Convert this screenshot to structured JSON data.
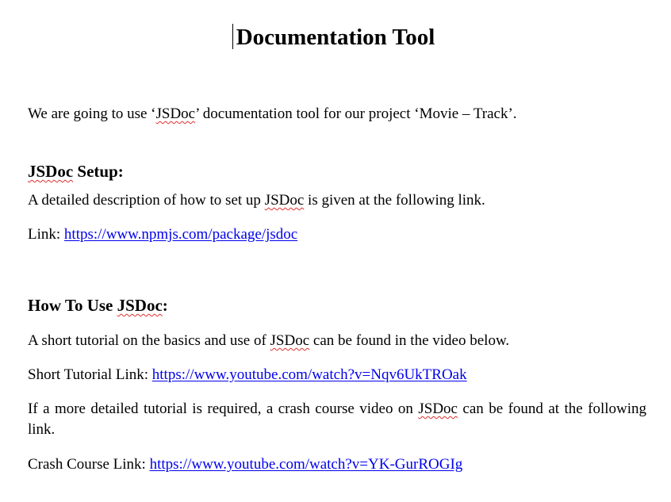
{
  "document": {
    "title": "Documentation Tool",
    "intro": {
      "pre": "We are going to use ‘",
      "tool": "JSDoc",
      "post": "’ documentation tool for our project ‘Movie – Track’."
    },
    "setup": {
      "heading_tool": "JSDoc",
      "heading_rest": " Setup:",
      "desc_pre": "A detailed description of how to set up ",
      "desc_tool": "JSDoc",
      "desc_post": " is given at the following link.",
      "link_label": "Link: ",
      "link_url": "https://www.npmjs.com/package/jsdoc"
    },
    "usage": {
      "heading_pre": "How To Use ",
      "heading_tool": "JSDoc",
      "heading_post": ":",
      "tutorial_pre": "A short tutorial on the basics and use of ",
      "tutorial_tool": "JSDoc",
      "tutorial_post": " can be found in the video below.",
      "short_label": "Short Tutorial Link: ",
      "short_url": "https://www.youtube.com/watch?v=Nqv6UkTROak",
      "crash_pre": "If a more detailed tutorial is required, a crash course video on ",
      "crash_tool": "JSDoc",
      "crash_post": " can be found at the following link.",
      "crash_label": "Crash Course Link: ",
      "crash_url": "https://www.youtube.com/watch?v=YK-GurROGIg"
    },
    "colors": {
      "link": "#0000ee",
      "spellcheck": "#e03030",
      "text": "#000000"
    }
  }
}
